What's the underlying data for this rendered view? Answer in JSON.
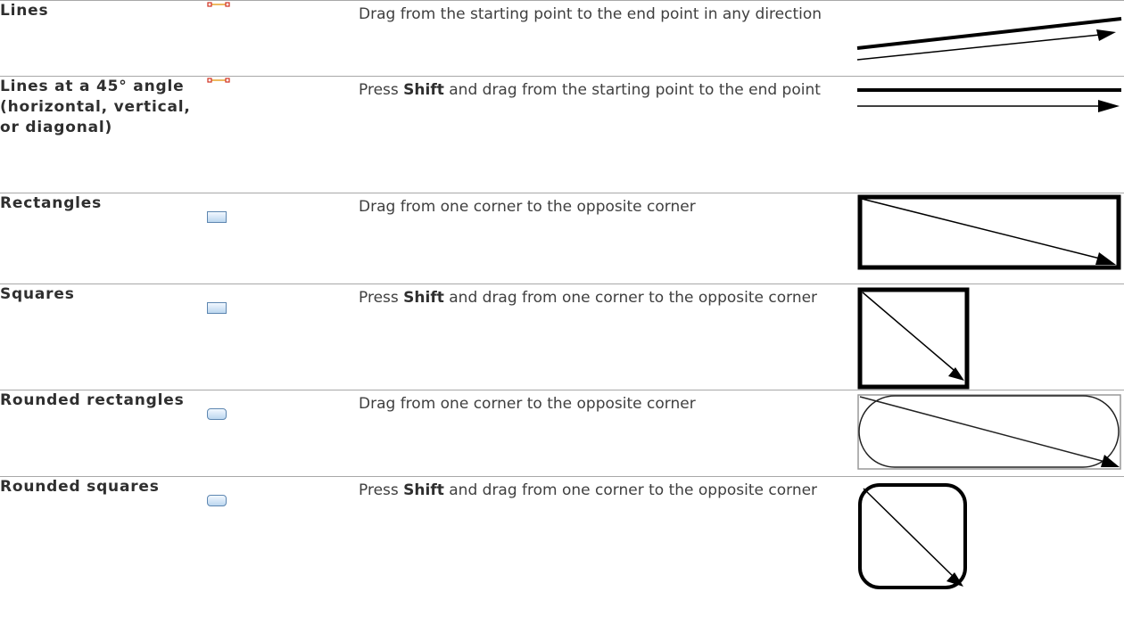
{
  "rows": [
    {
      "name": "Lines",
      "icon": "line-tool-icon",
      "description": [
        {
          "text": "Drag from the starting point to the end point in any direction",
          "bold": false
        }
      ],
      "illustration": "line-drawing-icon"
    },
    {
      "name": "Lines at a 45° angle (horizontal, vertical, or diagonal)",
      "icon": "line-tool-icon",
      "description": [
        {
          "text": "Press ",
          "bold": false
        },
        {
          "text": "Shift",
          "bold": true
        },
        {
          "text": " and drag from the starting point to the end point",
          "bold": false
        }
      ],
      "illustration": "straight-line-drawing-icon"
    },
    {
      "name": "Rectangles",
      "icon": "rectangle-tool-icon",
      "description": [
        {
          "text": "Drag from one corner to the opposite corner",
          "bold": false
        }
      ],
      "illustration": "rectangle-drawing-icon"
    },
    {
      "name": "Squares",
      "icon": "rectangle-tool-icon",
      "description": [
        {
          "text": "Press ",
          "bold": false
        },
        {
          "text": "Shift",
          "bold": true
        },
        {
          "text": " and drag from one corner to the opposite corner",
          "bold": false
        }
      ],
      "illustration": "square-drawing-icon"
    },
    {
      "name": "Rounded rectangles",
      "icon": "rounded-rectangle-tool-icon",
      "description": [
        {
          "text": "Drag from one corner to the opposite corner",
          "bold": false
        }
      ],
      "illustration": "rounded-rectangle-drawing-icon"
    },
    {
      "name": "Rounded squares",
      "icon": "rounded-rectangle-tool-icon",
      "description": [
        {
          "text": "Press ",
          "bold": false
        },
        {
          "text": "Shift",
          "bold": true
        },
        {
          "text": " and drag from one corner to the opposite corner",
          "bold": false
        }
      ],
      "illustration": "rounded-square-drawing-icon"
    }
  ]
}
